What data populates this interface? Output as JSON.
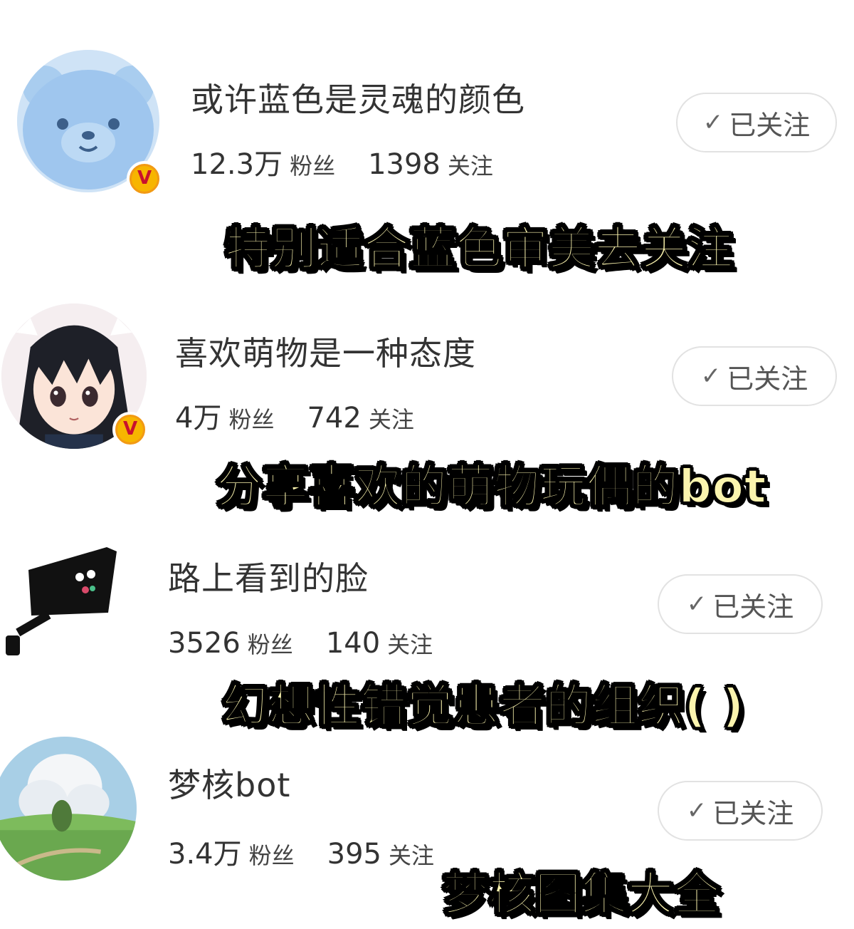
{
  "accounts": [
    {
      "name": "或许蓝色是灵魂的颜色",
      "fans_count": "12.3万",
      "fans_label": "粉丝",
      "following_count": "1398",
      "following_label": "关注",
      "follow_button": "已关注",
      "verified": true,
      "caption": "特别适合蓝色审美去关注"
    },
    {
      "name": "喜欢萌物是一种态度",
      "fans_count": "4万",
      "fans_label": "粉丝",
      "following_count": "742",
      "following_label": "关注",
      "follow_button": "已关注",
      "verified": true,
      "caption": "分享喜欢的萌物玩偶的bot"
    },
    {
      "name": "路上看到的脸",
      "fans_count": "3526",
      "fans_label": "粉丝",
      "following_count": "140",
      "following_label": "关注",
      "follow_button": "已关注",
      "verified": false,
      "caption": "幻想性错觉患者的组织( )"
    },
    {
      "name": "梦核bot",
      "fans_count": "3.4万",
      "fans_label": "粉丝",
      "following_count": "395",
      "following_label": "关注",
      "follow_button": "已关注",
      "verified": false,
      "caption": "梦核图集大全"
    }
  ],
  "verified_badge": "V",
  "colors": {
    "caption_fill": "#fbf4ae",
    "caption_stroke": "#000000",
    "verified_badge": "#f7b500",
    "button_border": "#e2e2e2"
  }
}
